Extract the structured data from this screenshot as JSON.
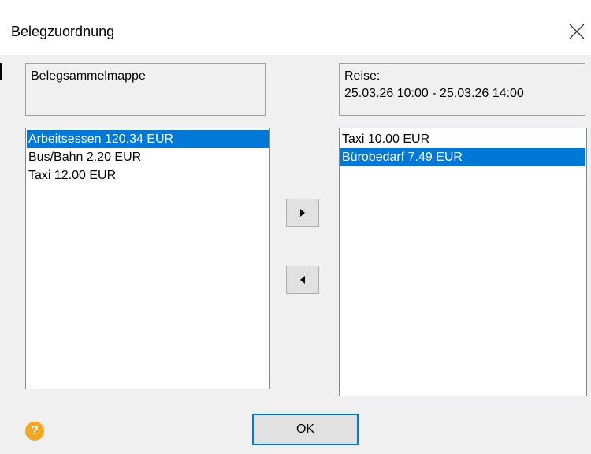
{
  "window": {
    "title": "Belegzuordnung"
  },
  "left_group": {
    "label": "Belegsammelmappe"
  },
  "right_group": {
    "line1": "Reise:",
    "line2": "25.03.26 10:00 - 25.03.26 14:00"
  },
  "left_list": {
    "items": [
      {
        "label": "Arbeitsessen 120.34 EUR",
        "selected": true
      },
      {
        "label": "Bus/Bahn 2.20 EUR",
        "selected": false
      },
      {
        "label": "Taxi 12.00 EUR",
        "selected": false
      }
    ]
  },
  "right_list": {
    "items": [
      {
        "label": "Taxi 10.00 EUR",
        "selected": false
      },
      {
        "label": "Bürobedarf 7.49 EUR",
        "selected": true
      }
    ]
  },
  "buttons": {
    "ok": "OK",
    "help": "?"
  },
  "icons": {
    "close": "close-icon",
    "move_right": "triangle-right-icon",
    "move_left": "triangle-left-icon",
    "help": "help-icon"
  },
  "colors": {
    "selection": "#0078d7",
    "help": "#f5a623"
  }
}
